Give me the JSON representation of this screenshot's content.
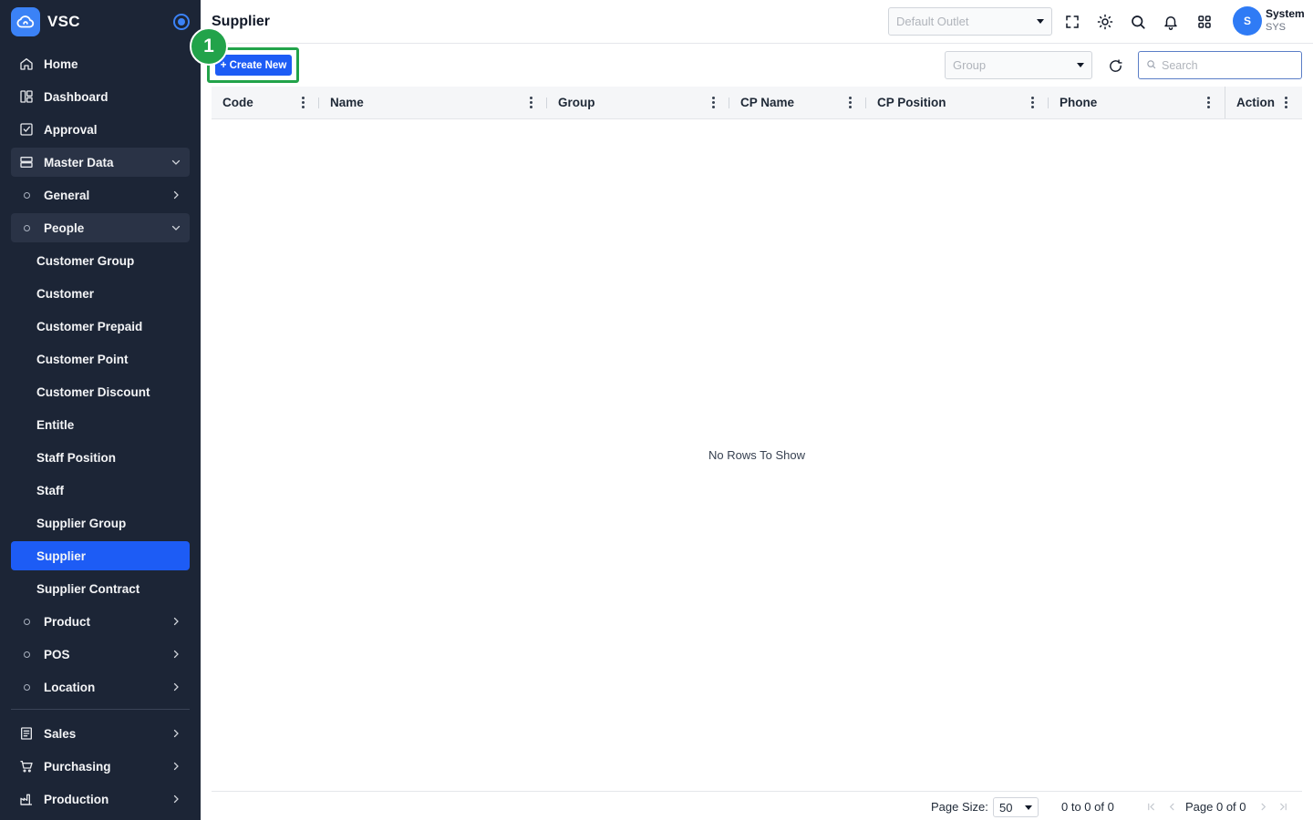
{
  "app": {
    "name": "VSC"
  },
  "sidebar": {
    "items": [
      {
        "label": "Home",
        "icon": "home-icon"
      },
      {
        "label": "Dashboard",
        "icon": "dashboard-icon"
      },
      {
        "label": "Approval",
        "icon": "approval-icon"
      },
      {
        "label": "Master Data",
        "icon": "server-icon",
        "expanded": true
      },
      {
        "label": "General"
      },
      {
        "label": "People",
        "expanded": true
      },
      {
        "label": "Customer Group"
      },
      {
        "label": "Customer"
      },
      {
        "label": "Customer Prepaid"
      },
      {
        "label": "Customer Point"
      },
      {
        "label": "Customer Discount"
      },
      {
        "label": "Entitle"
      },
      {
        "label": "Staff Position"
      },
      {
        "label": "Staff"
      },
      {
        "label": "Supplier Group"
      },
      {
        "label": "Supplier",
        "active": true
      },
      {
        "label": "Supplier Contract"
      },
      {
        "label": "Product"
      },
      {
        "label": "POS"
      },
      {
        "label": "Location"
      },
      {
        "label": "Sales",
        "icon": "sales-icon"
      },
      {
        "label": "Purchasing",
        "icon": "cart-icon"
      },
      {
        "label": "Production",
        "icon": "production-icon"
      }
    ]
  },
  "header": {
    "title": "Supplier",
    "outlet_placeholder": "Default Outlet",
    "user": {
      "initial": "S",
      "name": "System",
      "code": "SYS"
    }
  },
  "toolbar": {
    "create_label": "+ Create New",
    "step_number": "1",
    "group_placeholder": "Group",
    "search_placeholder": "Search"
  },
  "grid": {
    "columns": [
      "Code",
      "Name",
      "Group",
      "CP Name",
      "CP Position",
      "Phone",
      "Action"
    ],
    "empty_text": "No Rows To Show"
  },
  "footer": {
    "page_size_label": "Page Size:",
    "page_size_value": "50",
    "row_range": "0 to 0 of 0",
    "page_info": "Page 0 of 0"
  },
  "colors": {
    "sidebar_bg": "#1c2536",
    "accent": "#1d5cf5",
    "highlight": "#22a34a"
  }
}
